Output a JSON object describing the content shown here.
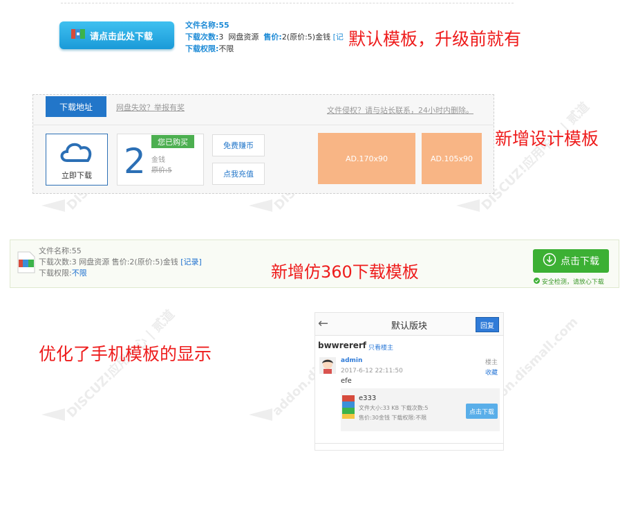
{
  "section1": {
    "download_button": "请点击此处下载",
    "file_name_label": "文件名称:",
    "file_name_value": "55",
    "downloads_label": "下载次数:",
    "downloads_value": "3",
    "source": "网盘资源",
    "price_label": "售价:",
    "price_value": "2(原价:5)金钱",
    "record_link": "[记",
    "permission_label": "下载权限:",
    "permission_value": "不限",
    "caption": "默认模板，升级前就有"
  },
  "section2": {
    "tab_label": "下载地址",
    "expired_link": "网盘失效？举报有奖",
    "copyright_link": "文件侵权？请与站长联系，24小时内删除。",
    "cloud_label": "立即下载",
    "bought_badge": "您已购买",
    "price_number": "2",
    "currency": "金钱",
    "original_price": "原价:5",
    "earn_button": "免费赚币",
    "recharge_button": "点我充值",
    "ad1": "AD.170x90",
    "ad2": "AD.105x90",
    "caption": "新增设计模板"
  },
  "section3": {
    "file_name": "文件名称:55",
    "downloads_line": "下载次数:3  网盘资源  售价:2(原价:5)金钱",
    "record_link": "[记录]",
    "permission_label": "下载权限:",
    "permission_value": "不限",
    "download_button": "点击下载",
    "safe_text": "安全检测，请放心下载",
    "caption": "新增仿360下载模板"
  },
  "section4": {
    "caption": "优化了手机模板的显示",
    "header_title": "默认版块",
    "reply_button": "回复",
    "thread_title": "bwwrererf",
    "only_op_link": "只看楼主",
    "author": "admin",
    "post_time": "2017-6-12 22:11:50",
    "floor_label": "楼主",
    "favorite_link": "收藏",
    "post_content": "efe",
    "file_name": "e333",
    "file_info": "文件大小:33 KB   下载次数:5",
    "file_price": "售价:30金钱   下载权限:不限",
    "download_button": "点击下载"
  },
  "watermark": {
    "text1": "DISCUZ!应用中心 | 贰道",
    "text2": "addon.dismall.com"
  },
  "colors": {
    "accent_blue": "#2276c9",
    "caption_red": "#ee1c1c",
    "green": "#3cb034",
    "ad_orange": "#f8b585"
  }
}
